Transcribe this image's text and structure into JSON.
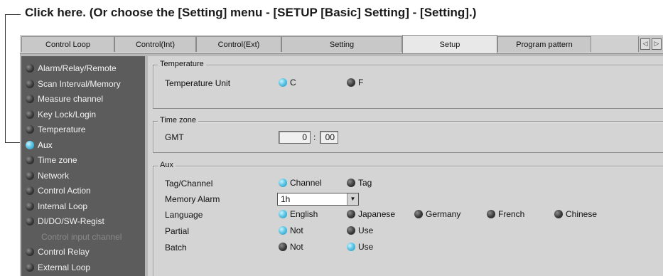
{
  "callout": "Click here. (Or choose the [Setting] menu - [SETUP [Basic] Setting] - [Setting].)",
  "tabs": [
    {
      "label": "Control Loop",
      "active": false
    },
    {
      "label": "Control(Int)",
      "active": false
    },
    {
      "label": "Control(Ext)",
      "active": false
    },
    {
      "label": "Setting",
      "active": false
    },
    {
      "label": "Setup",
      "active": true
    },
    {
      "label": "Program pattern",
      "active": false
    }
  ],
  "tab_scroll": {
    "left": "◁",
    "right": "▷"
  },
  "sidebar": {
    "items": [
      {
        "label": "Alarm/Relay/Remote",
        "led": "off"
      },
      {
        "label": "Scan Interval/Memory",
        "led": "off"
      },
      {
        "label": "Measure channel",
        "led": "off"
      },
      {
        "label": "Key Lock/Login",
        "led": "off"
      },
      {
        "label": "Temperature",
        "led": "off"
      },
      {
        "label": "Aux",
        "led": "on"
      },
      {
        "label": "Time zone",
        "led": "off"
      },
      {
        "label": "Network",
        "led": "off"
      },
      {
        "label": "Control Action",
        "led": "off"
      },
      {
        "label": "Internal Loop",
        "led": "off"
      },
      {
        "label": "DI/DO/SW-Regist",
        "led": "off"
      },
      {
        "label": "Control input channel",
        "led": "none"
      },
      {
        "label": "Control Relay",
        "led": "off"
      },
      {
        "label": "External Loop",
        "led": "off"
      }
    ]
  },
  "temperature": {
    "title": "Temperature",
    "unit_label": "Temperature Unit",
    "options": [
      {
        "label": "C",
        "selected": true
      },
      {
        "label": "F",
        "selected": false
      }
    ]
  },
  "timezone": {
    "title": "Time zone",
    "label": "GMT",
    "hours": "0",
    "separator": ":",
    "minutes": "00"
  },
  "aux": {
    "title": "Aux",
    "tag_channel": {
      "label": "Tag/Channel",
      "options": [
        {
          "label": "Channel",
          "selected": true
        },
        {
          "label": "Tag",
          "selected": false
        }
      ]
    },
    "memory_alarm": {
      "label": "Memory Alarm",
      "value": "1h"
    },
    "language": {
      "label": "Language",
      "options": [
        {
          "label": "English",
          "selected": true
        },
        {
          "label": "Japanese",
          "selected": false
        },
        {
          "label": "Germany",
          "selected": false
        },
        {
          "label": "French",
          "selected": false
        },
        {
          "label": "Chinese",
          "selected": false
        }
      ]
    },
    "partial": {
      "label": "Partial",
      "options": [
        {
          "label": "Not",
          "selected": true
        },
        {
          "label": "Use",
          "selected": false
        }
      ]
    },
    "batch": {
      "label": "Batch",
      "options": [
        {
          "label": "Not",
          "selected": false
        },
        {
          "label": "Use",
          "selected": true
        }
      ]
    }
  }
}
